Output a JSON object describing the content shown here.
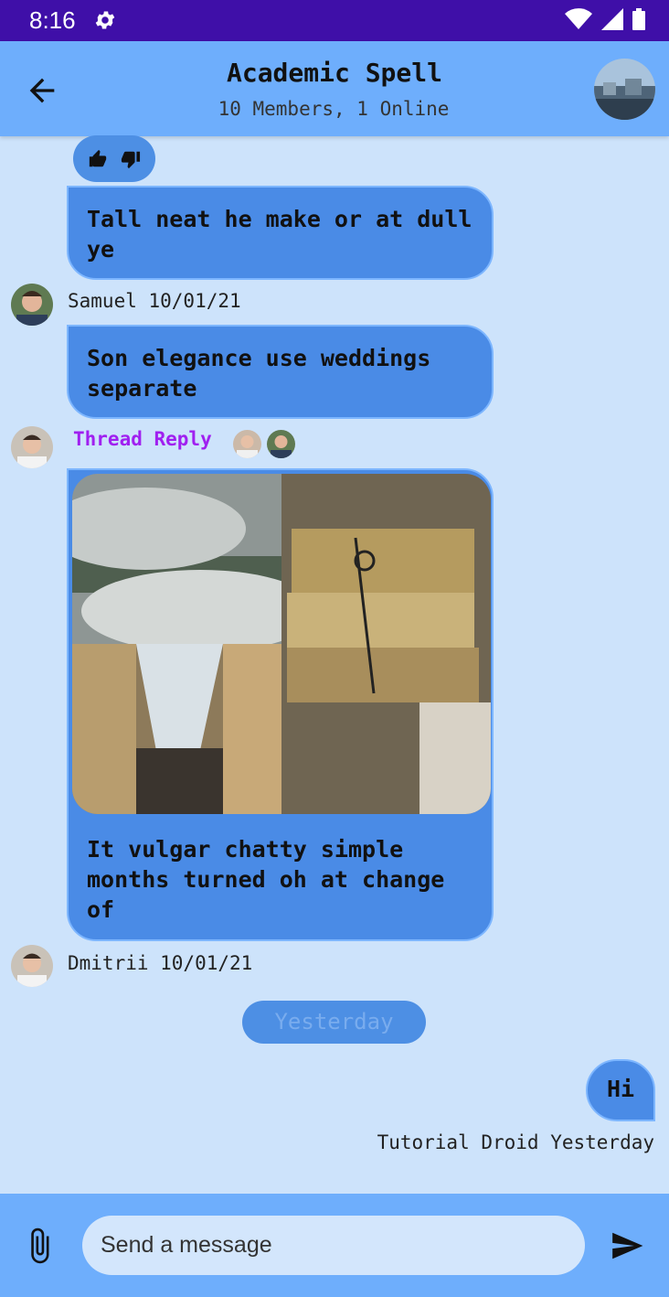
{
  "status_bar": {
    "time": "8:16"
  },
  "header": {
    "title": "Academic Spell",
    "subtitle": "10 Members,  1 Online"
  },
  "messages": [
    {
      "text": "Tall neat he make or at dull ye"
    },
    {
      "sender": "Samuel 10/01/21",
      "text": "Son elegance use weddings separate"
    },
    {
      "thread_label": "Thread Reply",
      "text": "It vulgar chatty simple months turned oh at change of"
    }
  ],
  "last_meta": "Dmitrii 10/01/21",
  "date_divider": "Yesterday",
  "outgoing": {
    "text": "Hi",
    "meta": "Tutorial Droid Yesterday"
  },
  "composer": {
    "placeholder": "Send a message"
  },
  "colors": {
    "status_bar": "#3f0fa8",
    "header": "#6eaefc",
    "background": "#cde3fb",
    "bubble": "#4a8be6",
    "thread": "#a020f0"
  }
}
